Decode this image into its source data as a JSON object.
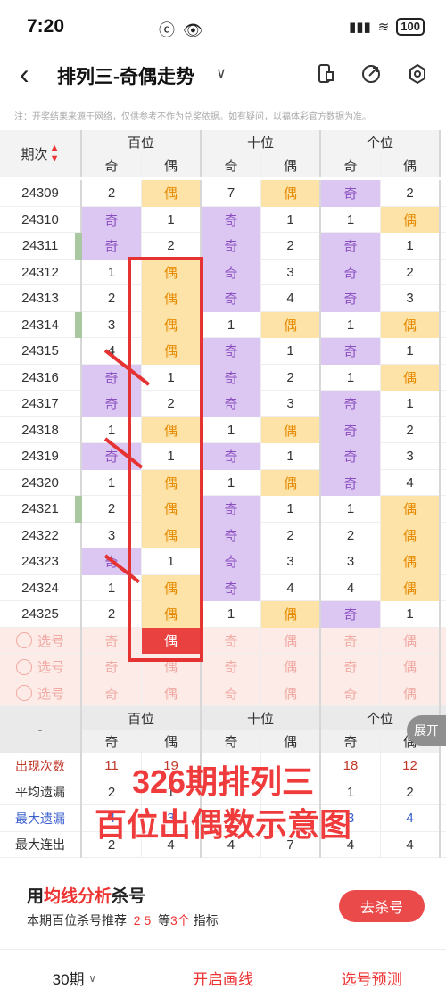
{
  "status": {
    "time": "7:20",
    "battery": "100"
  },
  "header": {
    "title": "排列三-奇偶走势",
    "caret": "∨"
  },
  "note": "注：开奖结果来源于网络，仅供参考不作为兑奖依据。如有疑问，以福体彩官方数据为准。",
  "table": {
    "issue_label": "期次",
    "groups": [
      "百位",
      "十位",
      "个位"
    ],
    "sub": [
      "奇",
      "偶"
    ],
    "rows": [
      [
        "24309",
        "2",
        "偶",
        "7",
        "偶",
        "奇",
        "2"
      ],
      [
        "24310",
        "奇",
        "1",
        "奇",
        "1",
        "1",
        "偶"
      ],
      [
        "24311",
        "奇",
        "2",
        "奇",
        "2",
        "奇",
        "1"
      ],
      [
        "24312",
        "1",
        "偶",
        "奇",
        "3",
        "奇",
        "2"
      ],
      [
        "24313",
        "2",
        "偶",
        "奇",
        "4",
        "奇",
        "3"
      ],
      [
        "24314",
        "3",
        "偶",
        "1",
        "偶",
        "1",
        "偶"
      ],
      [
        "24315",
        "4",
        "偶",
        "奇",
        "1",
        "奇",
        "1"
      ],
      [
        "24316",
        "奇",
        "1",
        "奇",
        "2",
        "1",
        "偶"
      ],
      [
        "24317",
        "奇",
        "2",
        "奇",
        "3",
        "奇",
        "1"
      ],
      [
        "24318",
        "1",
        "偶",
        "1",
        "偶",
        "奇",
        "2"
      ],
      [
        "24319",
        "奇",
        "1",
        "奇",
        "1",
        "奇",
        "3"
      ],
      [
        "24320",
        "1",
        "偶",
        "1",
        "偶",
        "奇",
        "4"
      ],
      [
        "24321",
        "2",
        "偶",
        "奇",
        "1",
        "1",
        "偶"
      ],
      [
        "24322",
        "3",
        "偶",
        "奇",
        "2",
        "2",
        "偶"
      ],
      [
        "24323",
        "奇",
        "1",
        "奇",
        "3",
        "3",
        "偶"
      ],
      [
        "24324",
        "1",
        "偶",
        "奇",
        "4",
        "4",
        "偶"
      ],
      [
        "24325",
        "2",
        "偶",
        "1",
        "偶",
        "奇",
        "1"
      ]
    ],
    "select_label": "选号",
    "select_cells": [
      "奇",
      "偶",
      "奇",
      "偶",
      "奇",
      "偶"
    ],
    "stats": [
      {
        "label": "出现次数",
        "values": [
          "11",
          "19",
          "",
          "",
          "18",
          "12"
        ]
      },
      {
        "label": "平均遗漏",
        "values": [
          "2",
          "1",
          "",
          "",
          "1",
          "2"
        ]
      },
      {
        "label": "最大遗漏",
        "values": [
          "4",
          "3",
          "",
          "",
          "3",
          "4"
        ]
      },
      {
        "label": "最大连出",
        "values": [
          "2",
          "4",
          "4",
          "7",
          "4",
          "4"
        ]
      }
    ],
    "dash": "-"
  },
  "overlay": {
    "line1": "326期排列三",
    "line2": "百位出偶数示意图"
  },
  "expand_label": "展开",
  "card": {
    "title_a": "用",
    "title_b": "均线分析",
    "title_c": "杀号",
    "sub_a": "本期百位杀号推荐",
    "sub_nums": "2 5",
    "sub_b": "等",
    "sub_count": "3个",
    "sub_c": "指标",
    "button": "去杀号"
  },
  "bottom": {
    "periods": "30期",
    "draw": "开启画线",
    "predict": "选号预测"
  },
  "colors": {
    "odd": "#dcc7f3",
    "even": "#fde3a8",
    "accent": "#e94040"
  }
}
